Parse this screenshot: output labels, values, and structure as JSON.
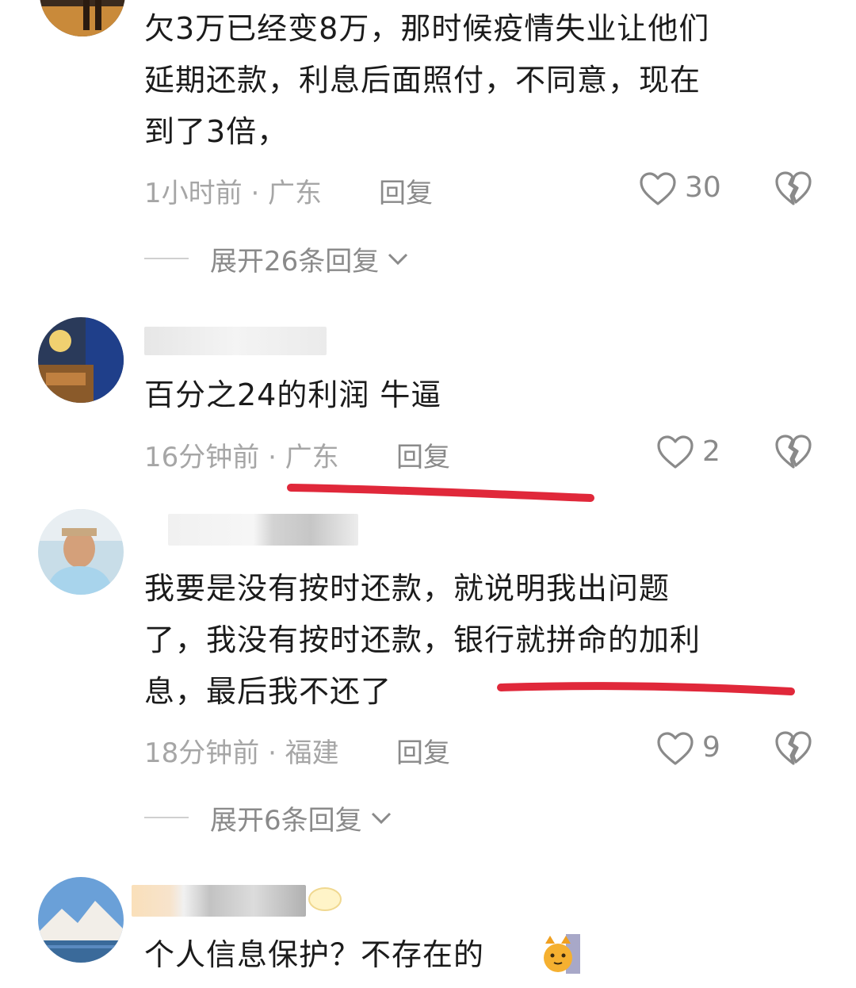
{
  "comments": [
    {
      "lines": [
        "欠3万已经变8万，那时候疫情失业让他们",
        "延期还款，利息后面照付，不同意，现在",
        "到了3倍，"
      ],
      "time": "1小时前 · 广东",
      "reply_label": "回复",
      "likes": "30",
      "expand_label": "展开26条回复"
    },
    {
      "lines": [
        "百分之24的利润 牛逼"
      ],
      "time": "16分钟前 · 广东",
      "reply_label": "回复",
      "likes": "2"
    },
    {
      "lines": [
        "我要是没有按时还款，就说明我出问题",
        "了，我没有按时还款，银行就拼命的加利",
        "息，最后我不还了"
      ],
      "time": "18分钟前 · 福建",
      "reply_label": "回复",
      "likes": "9",
      "expand_label": "展开6条回复"
    },
    {
      "lines": [
        "个人信息保护？不存在的"
      ],
      "emoji": "cat-emoji"
    }
  ],
  "icons": {
    "like": "heart-outline-icon",
    "dislike": "broken-heart-icon",
    "expand": "chevron-down-icon"
  },
  "colors": {
    "text": "#1b1b1b",
    "meta": "#a6a6a6",
    "highlight": "#e0283a"
  }
}
